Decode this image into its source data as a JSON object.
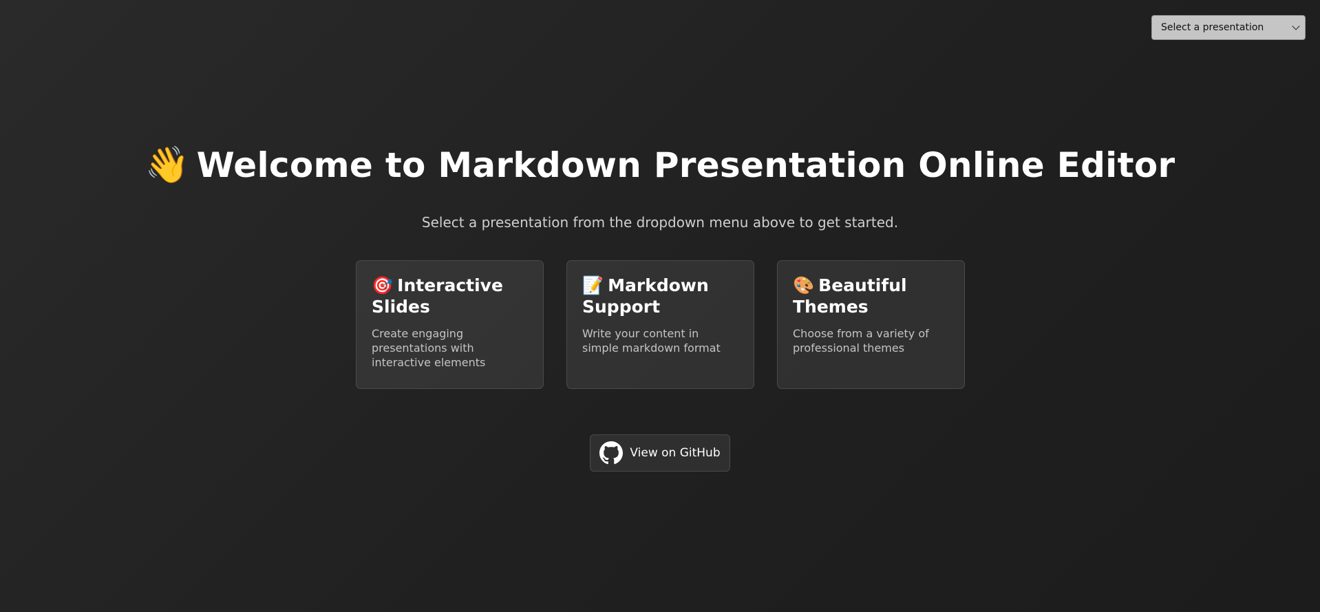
{
  "presentation_select": {
    "selected": "Select a presentation",
    "icon": "chevron-down-icon"
  },
  "hero": {
    "emoji": "👋",
    "title": "Welcome to Markdown Presentation Online Editor",
    "subtitle": "Select a presentation from the dropdown menu above to get started."
  },
  "features": [
    {
      "emoji": "🎯",
      "title": "Interactive Slides",
      "description": "Create engaging presentations with interactive elements"
    },
    {
      "emoji": "📝",
      "title": "Markdown Support",
      "description": "Write your content in simple markdown format"
    },
    {
      "emoji": "🎨",
      "title": "Beautiful Themes",
      "description": "Choose from a variety of professional themes"
    }
  ],
  "github_button": {
    "label": "View on GitHub",
    "icon": "github-icon"
  },
  "colors": {
    "background": "#232323",
    "text": "#ffffff",
    "muted_text": "#c4c4c4",
    "card_border": "#4a4a4a",
    "select_bg": "#c5c5c5"
  }
}
